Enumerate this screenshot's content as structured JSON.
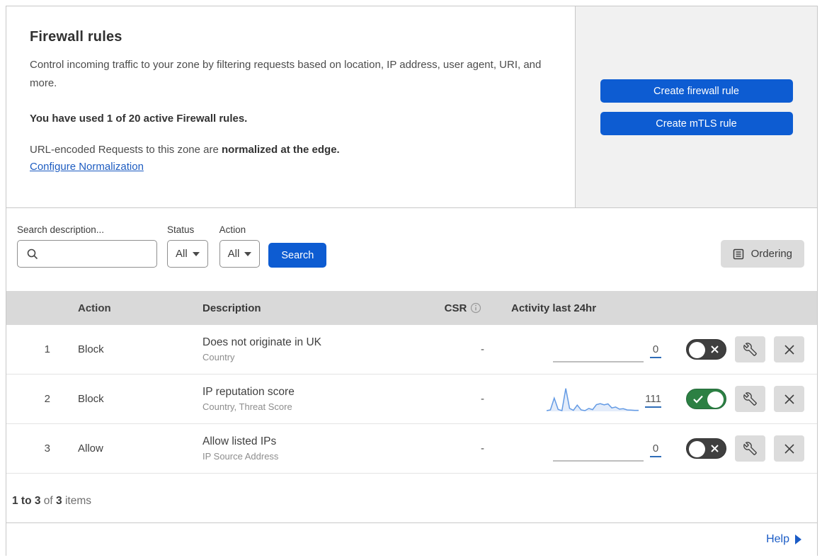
{
  "header": {
    "title": "Firewall rules",
    "description": "Control incoming traffic to your zone by filtering requests based on location, IP address, user agent, URI, and more.",
    "usage_bold": "You have used 1 of 20 active Firewall rules.",
    "normalization_prefix": "URL-encoded Requests to this zone are ",
    "normalization_bold": "normalized at the edge.",
    "normalization_link": "Configure Normalization"
  },
  "actions_panel": {
    "create_firewall_rule_label": "Create firewall rule",
    "create_mtls_rule_label": "Create mTLS rule"
  },
  "filters": {
    "search_label": "Search description...",
    "search_icon": "magnifier-icon",
    "status_label": "Status",
    "status_value": "All",
    "action_label": "Action",
    "action_value": "All",
    "search_button_label": "Search",
    "ordering_button_label": "Ordering",
    "ordering_icon": "list-document-icon"
  },
  "table": {
    "columns": {
      "action": "Action",
      "description": "Description",
      "csr": "CSR",
      "csr_icon": "info-icon",
      "activity": "Activity last 24hr"
    },
    "rows": [
      {
        "priority": "1",
        "action": "Block",
        "description": "Does not originate in UK",
        "fields": "Country",
        "csr": "-",
        "activity_count": "0",
        "enabled": false,
        "sparkline": []
      },
      {
        "priority": "2",
        "action": "Block",
        "description": "IP reputation score",
        "fields": "Country, Threat Score",
        "csr": "-",
        "activity_count": "111",
        "enabled": true,
        "sparkline": [
          3,
          6,
          55,
          8,
          3,
          95,
          12,
          4,
          26,
          6,
          3,
          12,
          7,
          28,
          32,
          27,
          31,
          14,
          18,
          9,
          11,
          6,
          5,
          4,
          4
        ]
      },
      {
        "priority": "3",
        "action": "Allow",
        "description": "Allow listed IPs",
        "fields": "IP Source Address",
        "csr": "-",
        "activity_count": "0",
        "enabled": false,
        "sparkline": []
      }
    ],
    "footer": {
      "range_bold": "1 to 3",
      "of_text": " of ",
      "total_bold": "3",
      "items_text": " items"
    }
  },
  "help": {
    "label": "Help"
  },
  "colors": {
    "accent_blue": "#0d5cd2",
    "link_blue": "#1d5cc1",
    "toggle_green": "#2c8043",
    "toggle_off_gray": "#3f3f3f",
    "table_header_gray": "#d9d9d9",
    "panel_gray": "#f1f1f1",
    "button_gray": "#dcdcdc",
    "sparkline_line": "#639ae4",
    "sparkline_fill": "#e3ecfa",
    "flatline_gray": "#a8a8a8"
  }
}
